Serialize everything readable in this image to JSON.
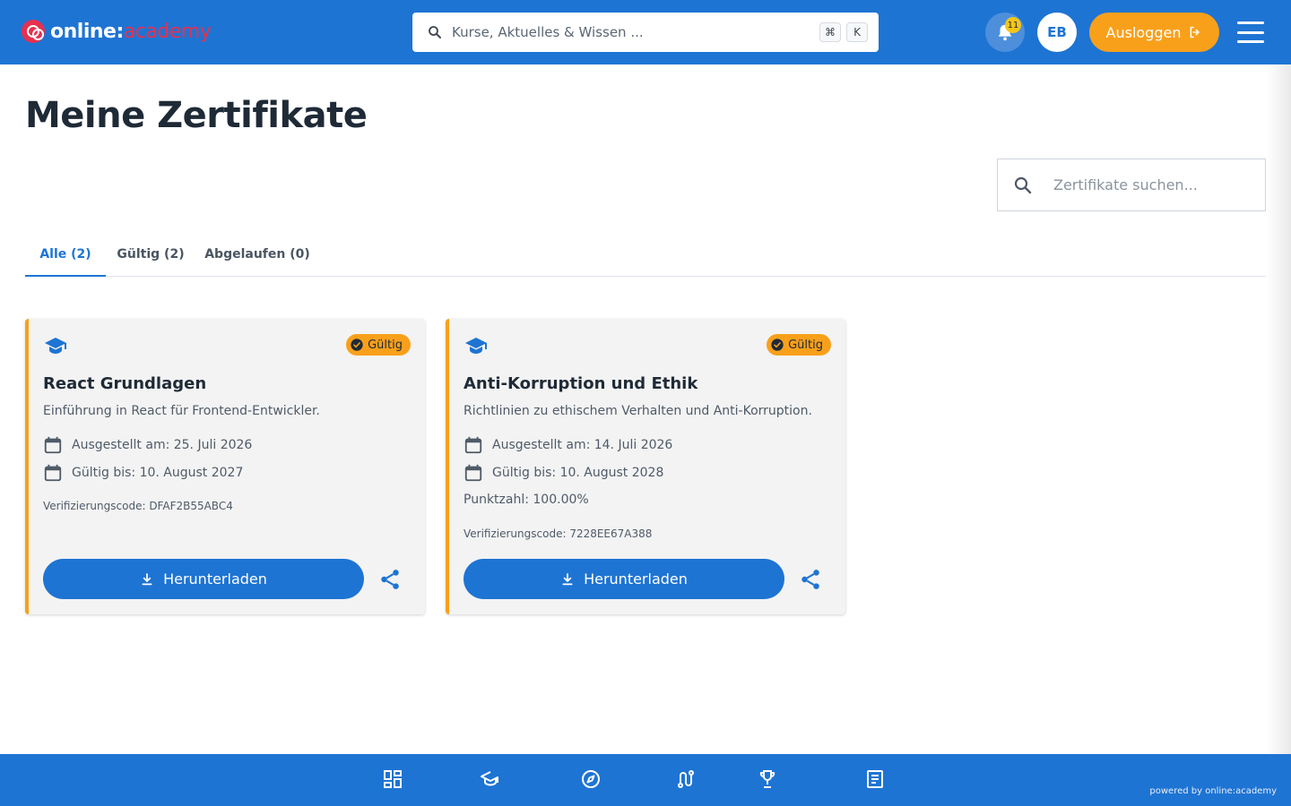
{
  "header": {
    "logo_part1": "online:",
    "logo_part2": "academy",
    "search_placeholder": "Kurse, Aktuelles & Wissen ...",
    "shortcut_key1": "⌘",
    "shortcut_key2": "K",
    "notification_count": "11",
    "avatar_initials": "EB",
    "logout_label": "Ausloggen"
  },
  "page": {
    "title": "Meine Zertifikate",
    "search_placeholder": "Zertifikate suchen..."
  },
  "tabs": [
    {
      "label": "Alle (2)",
      "active": true
    },
    {
      "label": "Gültig (2)",
      "active": false
    },
    {
      "label": "Abgelaufen (0)",
      "active": false
    }
  ],
  "certificates": [
    {
      "status": "Gültig",
      "title": "React Grundlagen",
      "description": "Einführung in React für Frontend-Entwickler.",
      "issued": "Ausgestellt am: 25. Juli 2026",
      "valid_until": "Gültig bis: 10. August 2027",
      "score": "",
      "verification": "Verifizierungscode: DFAF2B55ABC4",
      "download_label": "Herunterladen"
    },
    {
      "status": "Gültig",
      "title": "Anti-Korruption und Ethik",
      "description": "Richtlinien zu ethischem Verhalten und Anti-Korruption.",
      "issued": "Ausgestellt am: 14. Juli 2026",
      "valid_until": "Gültig bis: 10. August 2028",
      "score": "Punktzahl: 100.00%",
      "verification": "Verifizierungscode: 7228EE67A388",
      "download_label": "Herunterladen"
    }
  ],
  "footer": {
    "powered_by": "powered by online:academy",
    "nav_icons": [
      "dashboard-icon",
      "graduation-cap-icon",
      "compass-icon",
      "route-icon",
      "trophy-icon",
      "article-icon"
    ]
  },
  "colors": {
    "primary": "#1e74d3",
    "accent": "#f9a01b",
    "brand_red": "#e6304f"
  }
}
